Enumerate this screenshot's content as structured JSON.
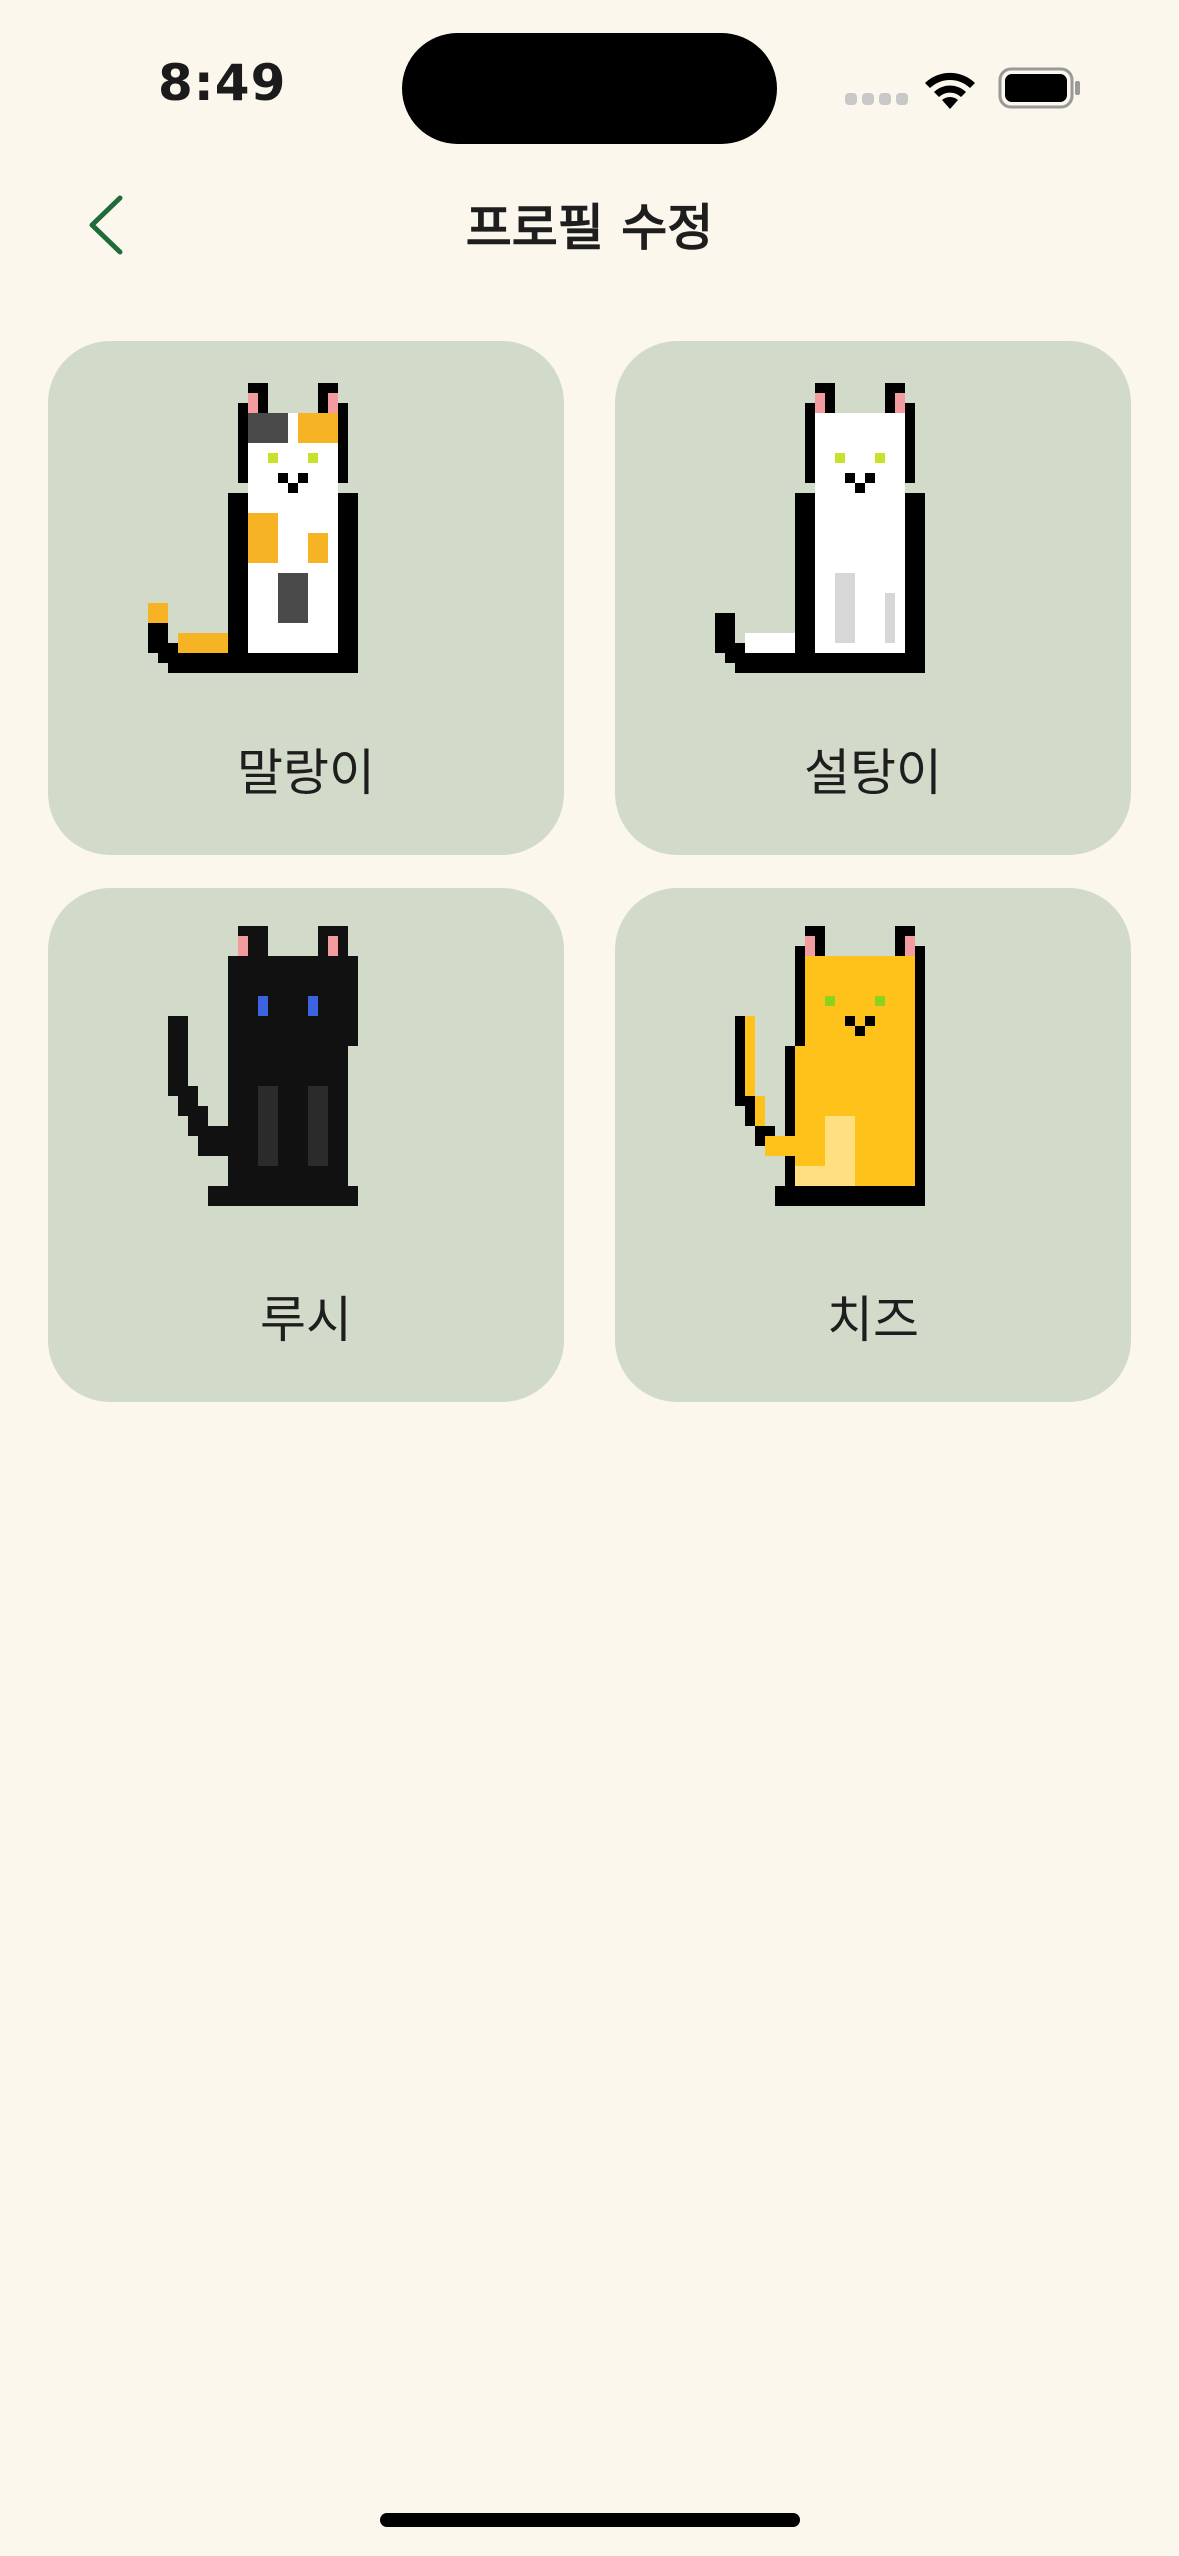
{
  "status_bar": {
    "time": "8:49"
  },
  "header": {
    "title": "프로필 수정"
  },
  "profiles": [
    {
      "name": "말랑이",
      "cat_icon": "calico-cat-icon"
    },
    {
      "name": "설탕이",
      "cat_icon": "white-cat-icon"
    },
    {
      "name": "루시",
      "cat_icon": "black-cat-icon"
    },
    {
      "name": "치즈",
      "cat_icon": "orange-cat-icon"
    }
  ],
  "colors": {
    "background": "#FBF7EC",
    "card": "#D2DBCA",
    "accent": "#1F6B3A"
  }
}
